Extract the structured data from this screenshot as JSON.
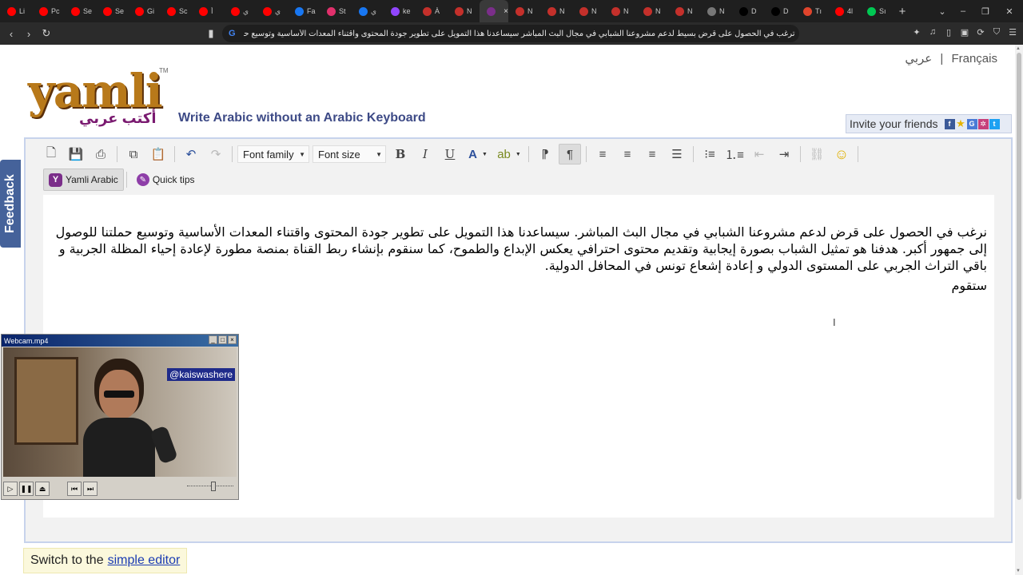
{
  "browser": {
    "tabs": [
      {
        "label": "Li",
        "color": "#ff0000"
      },
      {
        "label": "Pc",
        "color": "#ff0000"
      },
      {
        "label": "Se",
        "color": "#ff0000"
      },
      {
        "label": "Se",
        "color": "#ff0000"
      },
      {
        "label": "Gi",
        "color": "#ff0000"
      },
      {
        "label": "Sc",
        "color": "#ff0000"
      },
      {
        "label": "أ",
        "color": "#ff0000"
      },
      {
        "label": "ي",
        "color": "#ff0000"
      },
      {
        "label": "ي",
        "color": "#ff0000"
      },
      {
        "label": "Fa",
        "color": "#1877f2"
      },
      {
        "label": "St",
        "color": "#e1306c"
      },
      {
        "label": "ي",
        "color": "#1877f2"
      },
      {
        "label": "ke",
        "color": "#9146ff"
      },
      {
        "label": "À",
        "color": "#c4302b"
      },
      {
        "label": "N",
        "color": "#c4302b"
      },
      {
        "label": "",
        "color": "#7b2e8a",
        "active": true
      },
      {
        "label": "N",
        "color": "#c4302b"
      },
      {
        "label": "N",
        "color": "#c4302b"
      },
      {
        "label": "N",
        "color": "#c4302b"
      },
      {
        "label": "N",
        "color": "#c4302b"
      },
      {
        "label": "N",
        "color": "#c4302b"
      },
      {
        "label": "N",
        "color": "#c4302b"
      },
      {
        "label": "N",
        "color": "#777777"
      },
      {
        "label": "D",
        "color": "#000000"
      },
      {
        "label": "D",
        "color": "#000000"
      },
      {
        "label": "Tı",
        "color": "#e0442c"
      },
      {
        "label": "4l",
        "color": "#ff0000"
      },
      {
        "label": "Sı",
        "color": "#00c853"
      }
    ],
    "new_tab": "+",
    "address": "ترغب في الحصول على قرض بسيط لدعم مشروعنا الشبابي في مجال البث المباشر سيساعدنا هذا التمويل على تطوير جودة المحتوى واقتناء المعدات الأساسية وتوسيع حملتنا للوص..."
  },
  "header": {
    "lang_arabic": "عربي",
    "lang_separator": "|",
    "lang_french": "Français",
    "logo_word": "yamli",
    "logo_tm": "TM",
    "logo_arabic": "أكتب عربي",
    "tagline": "Write Arabic without an Arabic Keyboard",
    "invite": "Invite your friends"
  },
  "feedback_label": "Feedback",
  "editor": {
    "font_family": "Font family",
    "font_size": "Font size",
    "yamli_btn": "Yamli Arabic",
    "quick_tips": "Quick tips",
    "paragraph1": "نرغب في الحصول على قرض لدعم مشروعنا الشبابي في مجال البث المباشر. سيساعدنا هذا التمويل على تطوير جودة المحتوى واقتناء المعدات الأساسية وتوسيع حملتنا للوصول إلى جمهور أكبر. هدفنا هو تمثيل الشباب بصورة إيجابية وتقديم محتوى احترافي يعكس الإبداع والطموح، كما سنقوم بإنشاء ربط القناة بمنصة مطورة لإعادة إحياء المظلة الجربية و باقي التراث الجربي على المستوى الدولي و إعادة إشعاع تونس في المحافل الدولية.",
    "paragraph2": "ستقوم"
  },
  "switch": {
    "prefix": "Switch to the",
    "link": "simple editor"
  },
  "webcam": {
    "title": "Webcam.mp4",
    "handle": "@kaiswashere"
  }
}
